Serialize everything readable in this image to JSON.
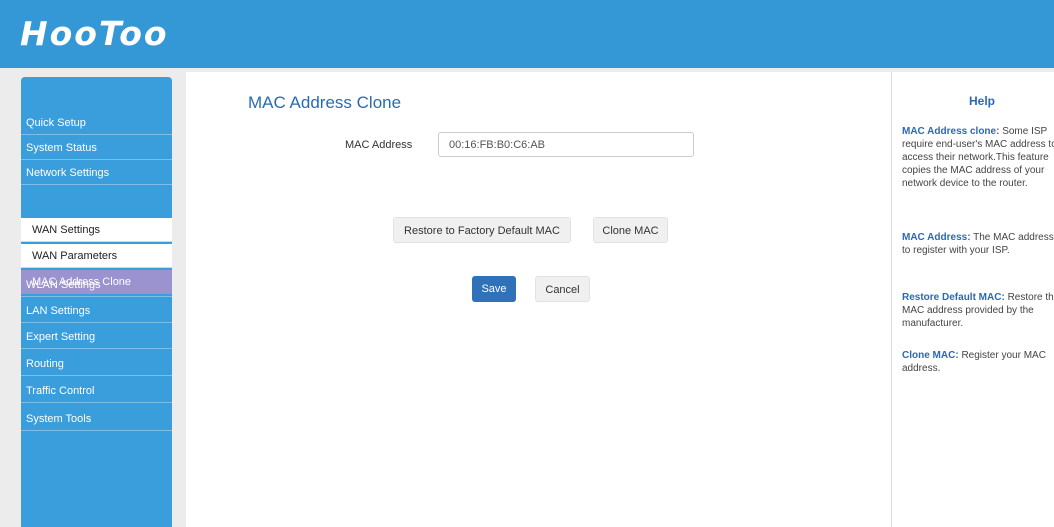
{
  "brand": {
    "logo": "HooToo"
  },
  "sidebar": {
    "items": [
      {
        "label": "Quick Setup"
      },
      {
        "label": "System Status"
      },
      {
        "label": "Network Settings"
      },
      {
        "label": "WAN Settings"
      },
      {
        "label": "WAN Parameters"
      },
      {
        "label": "MAC Address Clone"
      },
      {
        "label": "WLAN Settings"
      },
      {
        "label": "LAN Settings"
      },
      {
        "label": "Expert Setting"
      },
      {
        "label": "Routing"
      },
      {
        "label": "Traffic Control"
      },
      {
        "label": "System Tools"
      }
    ]
  },
  "main": {
    "title": "MAC Address Clone",
    "mac_label": "MAC Address",
    "mac_value": "00:16:FB:B0:C6:AB",
    "restore_label": "Restore to Factory Default MAC",
    "clone_label": "Clone MAC",
    "save_label": "Save",
    "cancel_label": "Cancel"
  },
  "help": {
    "title": "Help",
    "blocks": [
      {
        "term": "MAC Address clone:",
        "text": " Some ISP require end-user's MAC address to access their network.This feature copies the MAC address of your network device to the router."
      },
      {
        "term": "MAC Address:",
        "text": " The MAC address to register with your ISP."
      },
      {
        "term": "Restore Default MAC:",
        "text": " Restore the MAC address provided by the manufacturer."
      },
      {
        "term": "Clone MAC:",
        "text": " Register your MAC address."
      }
    ]
  },
  "colors": {
    "header": "#3497d6",
    "sidebar": "#3a9ddc",
    "active_item": "#9b93cf",
    "accent": "#2a6ab5",
    "save_button": "#2f72b8"
  }
}
